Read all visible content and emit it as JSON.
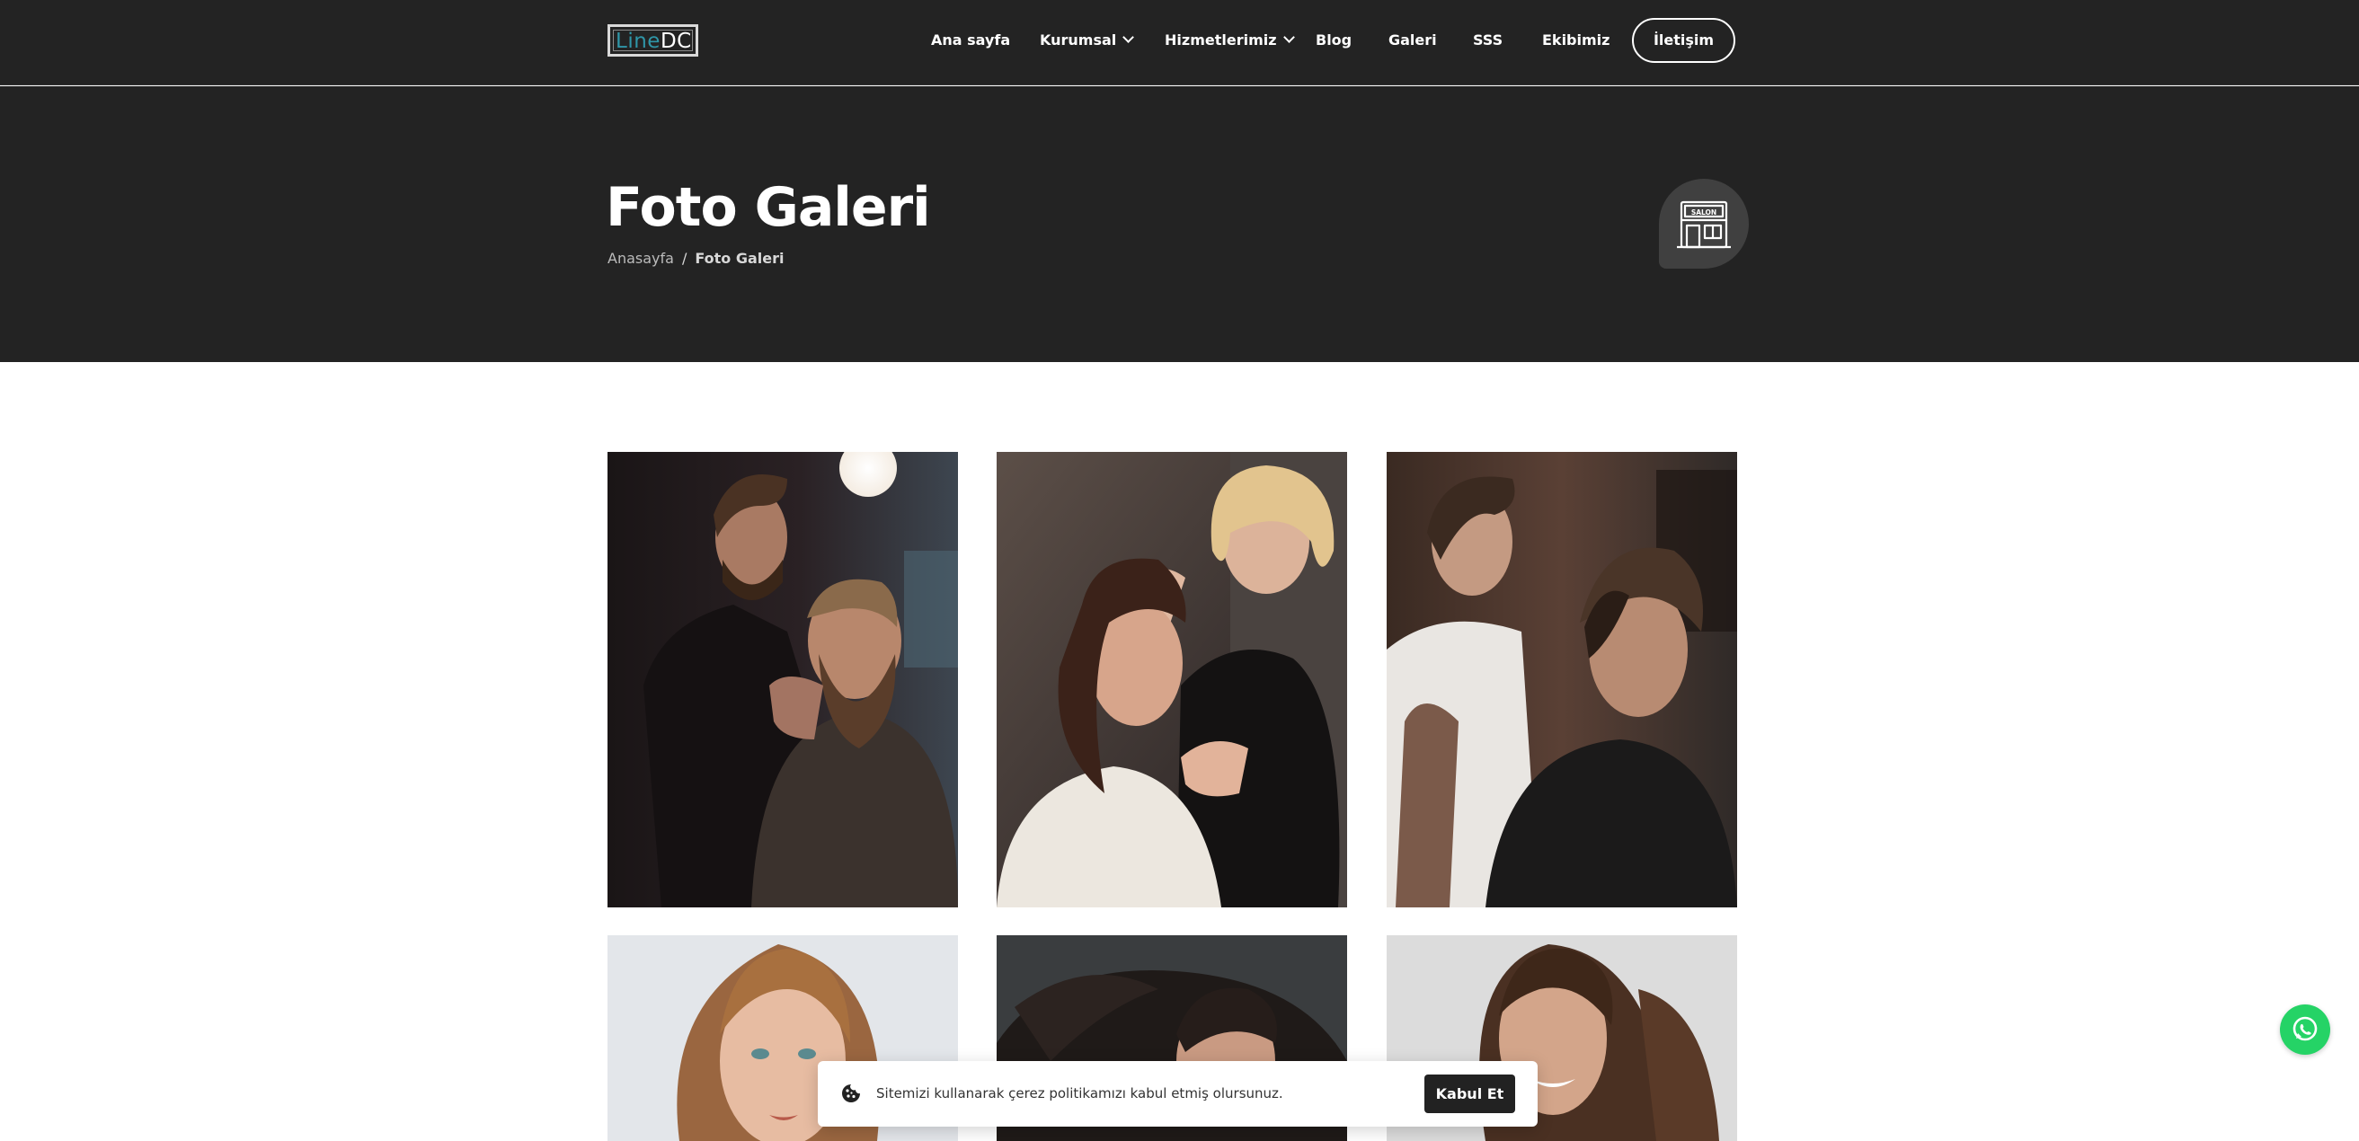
{
  "brand": {
    "logo_line": "Line",
    "logo_dc": "DC",
    "accent": "#2f96a8"
  },
  "nav": {
    "items": [
      {
        "label": "Ana sayfa",
        "dropdown": false
      },
      {
        "label": "Kurumsal",
        "dropdown": true
      },
      {
        "label": "Hizmetlerimiz",
        "dropdown": true
      },
      {
        "label": "Blog",
        "dropdown": false
      },
      {
        "label": "Galeri",
        "dropdown": false
      },
      {
        "label": "SSS",
        "dropdown": false
      },
      {
        "label": "Ekibimiz",
        "dropdown": false
      }
    ],
    "contact_label": "İletişim"
  },
  "hero": {
    "title": "Foto Galeri",
    "breadcrumb_home": "Anasayfa",
    "breadcrumb_sep": "/",
    "breadcrumb_current": "Foto Galeri",
    "badge_icon": "salon-storefront-icon",
    "badge_text": "SALON"
  },
  "gallery": {
    "photos": [
      {
        "name": "gallery-photo-barber-beard",
        "alt": "barber styling man's beard"
      },
      {
        "name": "gallery-photo-blonde-stylist",
        "alt": "blonde stylist cutting hair"
      },
      {
        "name": "gallery-photo-tattooed-barber",
        "alt": "tattooed barber with undercut client"
      },
      {
        "name": "gallery-photo-woman-long-hair",
        "alt": "woman with long wavy hair"
      },
      {
        "name": "gallery-photo-hair-flip",
        "alt": "woman with flowing dark hair"
      },
      {
        "name": "gallery-photo-smiling-woman",
        "alt": "smiling woman with wavy hair"
      }
    ]
  },
  "cookie": {
    "icon": "cookie-icon",
    "text": "Sitemizi kullanarak çerez politikamızı kabul etmiş olursunuz.",
    "accept_label": "Kabul Et"
  },
  "whatsapp": {
    "icon": "whatsapp-icon",
    "color": "#25d366"
  },
  "colors": {
    "header_bg": "#232323",
    "hero_bg": "#232323",
    "button_dark": "#222222"
  }
}
